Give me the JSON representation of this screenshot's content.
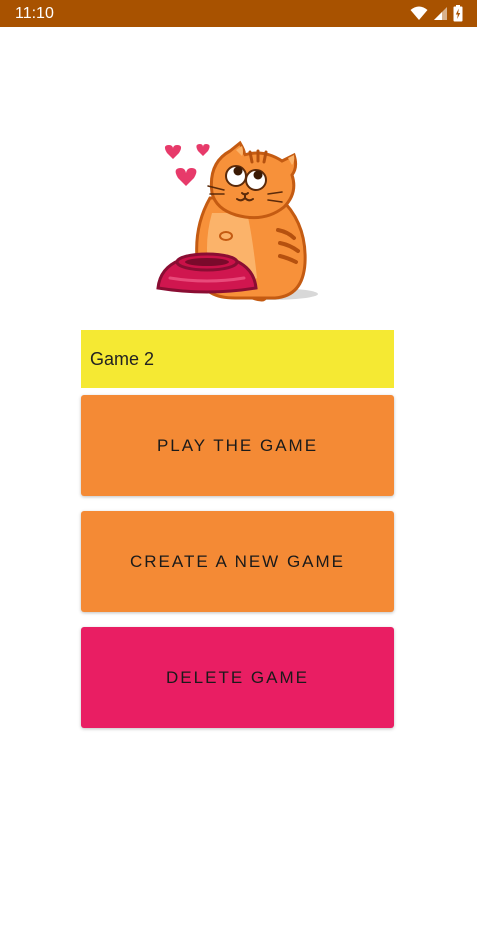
{
  "status_bar": {
    "time": "11:10",
    "background": "#a85200",
    "icons": [
      "wifi-icon",
      "cellular-signal-icon",
      "battery-charging-icon"
    ]
  },
  "illustration": {
    "icon": "cat-with-food-bowl-and-hearts-icon"
  },
  "game_field": {
    "value": "Game 2",
    "background": "#f5e933"
  },
  "buttons": {
    "play_label": "PLAY THE GAME",
    "create_label": "CREATE A NEW GAME",
    "delete_label": "DELETE GAME",
    "orange": "#f48a35",
    "pink": "#e91e63"
  }
}
